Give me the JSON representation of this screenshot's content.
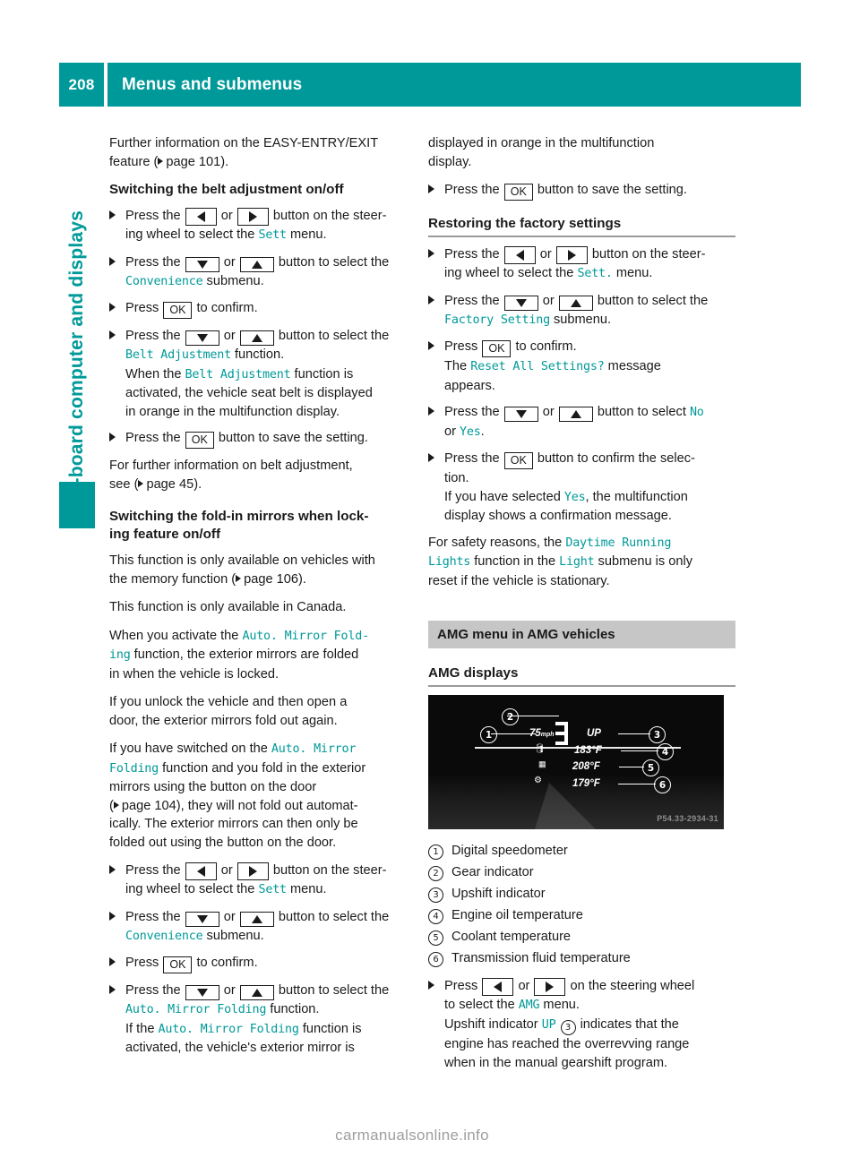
{
  "theme": {
    "teal": "#009999",
    "band_gray": "#c6c6c6",
    "rule_gray": "#9a9a9a"
  },
  "header": {
    "page_number": "208",
    "title": "Menus and submenus"
  },
  "sidetab": {
    "label": "On-board computer and displays"
  },
  "left_column": {
    "intro": {
      "line1": "Further information on the EASY-ENTRY/EXIT",
      "line2_pre": "feature (",
      "line2_page": "page 101",
      "line2_post": ")."
    },
    "heading_belt": "Switching the belt adjustment on/off",
    "belt_steps": {
      "s1_a": "Press the",
      "s1_or": "or",
      "s1_b": "button on the steer-",
      "s1_c": "ing wheel to select the",
      "s1_menu": "Sett",
      "s1_d": "menu.",
      "s2_a": "Press the",
      "s2_or": "or",
      "s2_b": "button to select the",
      "s2_menu": "Convenience",
      "s2_c": "submenu.",
      "s3_a": "Press",
      "s3_key": "OK",
      "s3_b": "to confirm.",
      "s4_a": "Press the",
      "s4_or": "or",
      "s4_b": "button to select the",
      "s4_fn": "Belt Adjustment",
      "s4_c": "function.",
      "s4_d": "When the",
      "s4_fn2": "Belt Adjustment",
      "s4_e": "function is",
      "s4_f": "activated, the vehicle seat belt is displayed",
      "s4_g": "in orange in the multifunction display.",
      "s5_a": "Press the",
      "s5_key": "OK",
      "s5_b": "button to save the setting."
    },
    "belt_note": {
      "l1": "For further information on belt adjustment,",
      "l2_pre": "see (",
      "l2_page": "page 45",
      "l2_post": ")."
    },
    "heading_mirrors_l1": "Switching the fold-in mirrors when lock-",
    "heading_mirrors_l2": "ing feature on/off",
    "mirror_paras": {
      "p1_a": "This function is only available on vehicles with",
      "p1_b": "the memory function (",
      "p1_page": "page 106",
      "p1_c": ").",
      "p2": "This function is only available in Canada.",
      "p3_a": "When you activate the",
      "p3_fn": "Auto. Mirror Fold-",
      "p3_fn2": "ing",
      "p3_b": "function, the exterior mirrors are folded",
      "p3_c": "in when the vehicle is locked.",
      "p4_a": "If you unlock the vehicle and then open a",
      "p4_b": "door, the exterior mirrors fold out again.",
      "p5_a": "If you have switched on the",
      "p5_fn": "Auto. Mirror",
      "p5_fn2": "Folding",
      "p5_b": "function and you fold in the exterior",
      "p5_c": "mirrors using the button on the door",
      "p5_pre": "(",
      "p5_page": "page 104",
      "p5_d": "), they will not fold out automat-",
      "p5_e": "ically. The exterior mirrors can then only be",
      "p5_f": "folded out using the button on the door."
    },
    "mirror_steps": {
      "s1_a": "Press the",
      "s1_or": "or",
      "s1_b": "button on the steer-",
      "s1_c": "ing wheel to select the",
      "s1_menu": "Sett",
      "s1_d": "menu.",
      "s2_a": "Press the",
      "s2_or": "or",
      "s2_b": "button to select the",
      "s2_menu": "Convenience",
      "s2_c": "submenu.",
      "s3_a": "Press",
      "s3_key": "OK",
      "s3_b": "to confirm.",
      "s4_a": "Press the",
      "s4_or": "or",
      "s4_b": "button to select the",
      "s4_fn": "Auto. Mirror Folding",
      "s4_c": "function.",
      "s4_d": "If the",
      "s4_fn2": "Auto. Mirror Folding",
      "s4_e": "function is",
      "s4_f": "activated, the vehicle's exterior mirror is"
    }
  },
  "right_column": {
    "cont": {
      "l1": "displayed in orange in the multifunction",
      "l2": "display.",
      "s_a": "Press the",
      "s_key": "OK",
      "s_b": "button to save the setting."
    },
    "heading_factory": "Restoring the factory settings",
    "factory_steps": {
      "s1_a": "Press the",
      "s1_or": "or",
      "s1_b": "button on the steer-",
      "s1_c": "ing wheel to select the",
      "s1_menu": "Sett.",
      "s1_d": "menu.",
      "s2_a": "Press the",
      "s2_or": "or",
      "s2_b": "button to select the",
      "s2_menu": "Factory Setting",
      "s2_c": "submenu.",
      "s3_a": "Press",
      "s3_key": "OK",
      "s3_b": "to confirm.",
      "s3_c": "The",
      "s3_msg": "Reset All Settings?",
      "s3_d": "message",
      "s3_e": "appears.",
      "s4_a": "Press the",
      "s4_or": "or",
      "s4_b": "button to select",
      "s4_no": "No",
      "s4_c": "or",
      "s4_yes": "Yes",
      "s4_d": ".",
      "s5_a": "Press the",
      "s5_key": "OK",
      "s5_b": "button to confirm the selec-",
      "s5_c": "tion.",
      "s5_d": "If you have selected",
      "s5_yes": "Yes",
      "s5_e": ", the multifunction",
      "s5_f": "display shows a confirmation message."
    },
    "safety_note": {
      "a": "For safety reasons, the",
      "fn": "Daytime Running",
      "fn2": "Lights",
      "b": "function in the",
      "menu": "Light",
      "c": "submenu is only",
      "d": "reset if the vehicle is stationary."
    },
    "band_amg": "AMG menu in AMG vehicles",
    "heading_amg_displays": "AMG displays",
    "figure": {
      "speed": "75",
      "speed_unit": "mph",
      "upshift": "UP",
      "oil_temp": "183°F",
      "coolant_temp": "208°F",
      "trans_temp": "179°F",
      "image_id": "P54.33-2934-31",
      "callouts": [
        "1",
        "2",
        "3",
        "4",
        "5",
        "6"
      ]
    },
    "legend": [
      {
        "num": "1",
        "label": "Digital speedometer"
      },
      {
        "num": "2",
        "label": "Gear indicator"
      },
      {
        "num": "3",
        "label": "Upshift indicator"
      },
      {
        "num": "4",
        "label": "Engine oil temperature"
      },
      {
        "num": "5",
        "label": "Coolant temperature"
      },
      {
        "num": "6",
        "label": "Transmission fluid temperature"
      }
    ],
    "amg_step": {
      "a": "Press",
      "or": "or",
      "b": "on the steering wheel",
      "c": "to select the",
      "menu": "AMG",
      "d": "menu.",
      "e": "Upshift indicator",
      "up": "UP",
      "num": "3",
      "f": "indicates that the",
      "g": "engine has reached the overrevving range",
      "h": "when in the manual gearshift program."
    }
  },
  "watermark": "carmanualsonline.info"
}
